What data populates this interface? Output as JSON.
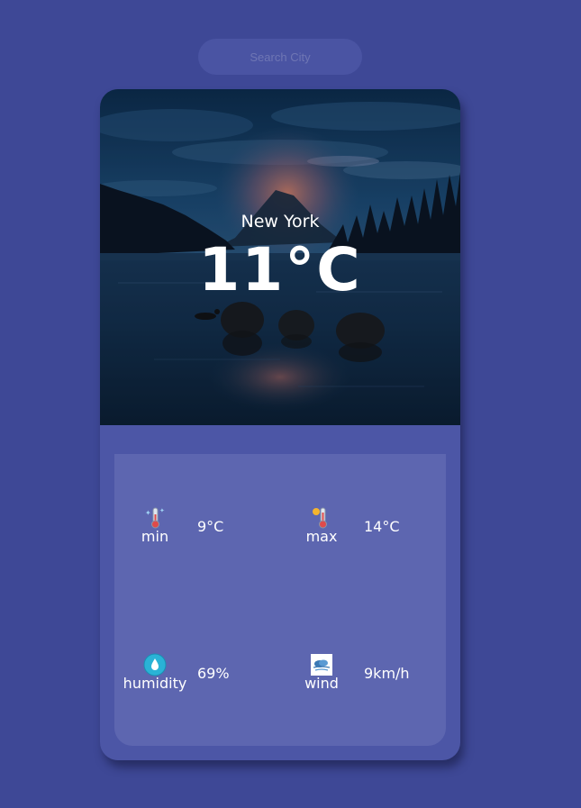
{
  "search": {
    "placeholder": "Search City"
  },
  "weather": {
    "city": "New York",
    "temperature": "11°C"
  },
  "stats": {
    "min": {
      "label": "min",
      "value": "9°C",
      "icon": "thermometer-cold-icon"
    },
    "max": {
      "label": "max",
      "value": "14°C",
      "icon": "thermometer-hot-icon"
    },
    "humidity": {
      "label": "humidity",
      "value": "69%",
      "icon": "water-drop-icon"
    },
    "wind": {
      "label": "wind",
      "value": "9km/h",
      "icon": "wind-icon"
    }
  },
  "colors": {
    "background": "#3e4896",
    "card": "#4c56a6",
    "details_panel": "#5d66b0",
    "text": "#ffffff"
  }
}
